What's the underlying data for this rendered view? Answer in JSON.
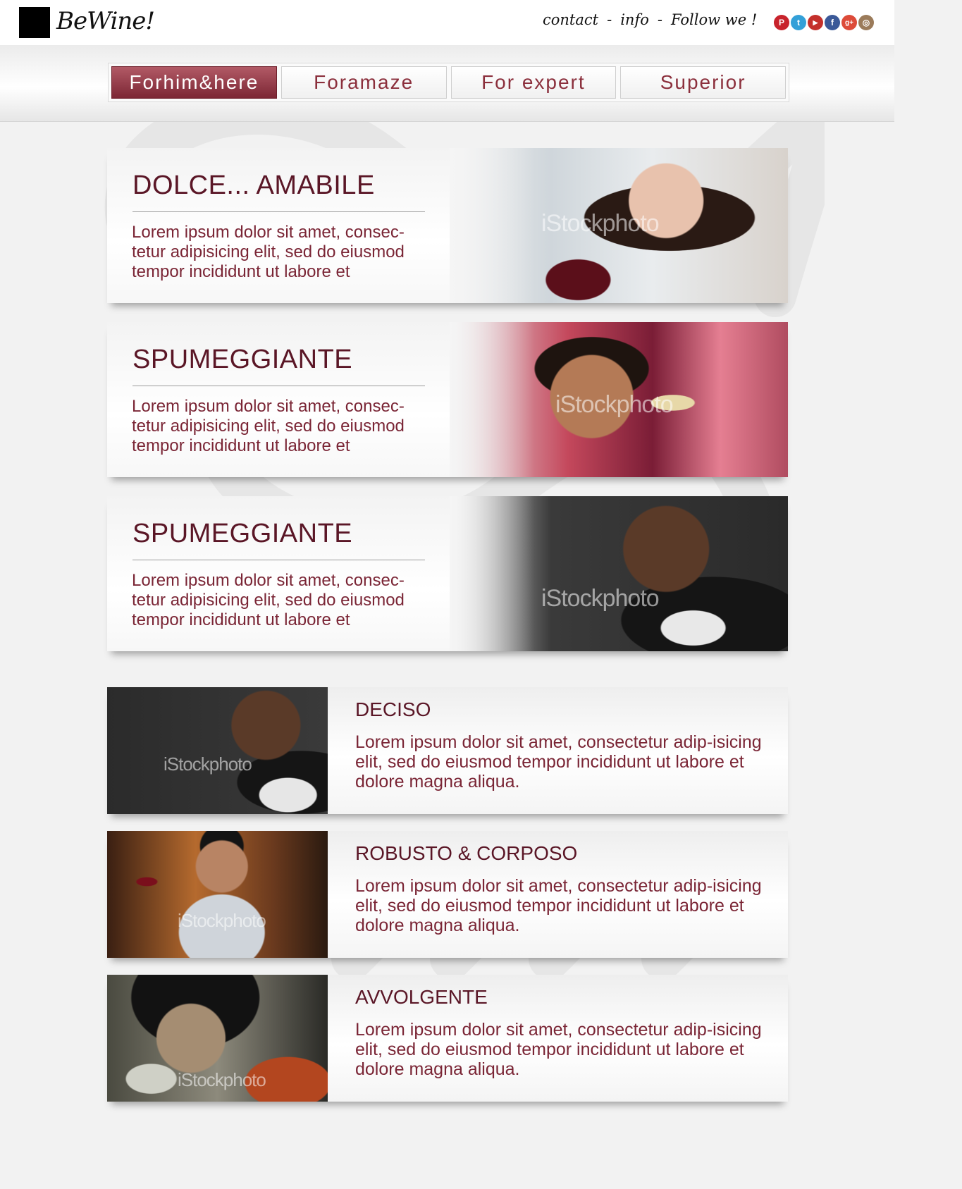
{
  "header": {
    "logo": "BeWine!",
    "links": [
      "contact",
      "info",
      "Follow we !"
    ],
    "separator": "-",
    "socials": [
      {
        "name": "pinterest-icon",
        "glyph": "P",
        "color": "#c8232c"
      },
      {
        "name": "twitter-icon",
        "glyph": "t",
        "color": "#33a0d8"
      },
      {
        "name": "youtube-icon",
        "glyph": "▶",
        "color": "#c4302b"
      },
      {
        "name": "facebook-icon",
        "glyph": "f",
        "color": "#3b5998"
      },
      {
        "name": "googleplus-icon",
        "glyph": "g+",
        "color": "#dd4b39"
      },
      {
        "name": "instagram-icon",
        "glyph": "◎",
        "color": "#9b7b5a"
      }
    ]
  },
  "nav": {
    "tabs": [
      "Forhim&here",
      "Foramaze",
      "For expert",
      "Superior"
    ],
    "active_index": 0
  },
  "featured": [
    {
      "title": "DOLCE... AMABILE",
      "body": "Lorem ipsum dolor sit amet, consec-tetur adipisicing elit, sed do eiusmod tempor incididunt ut labore et",
      "watermark": "iStockphoto"
    },
    {
      "title": "SPUMEGGIANTE",
      "body": "Lorem ipsum dolor sit amet, consec-tetur adipisicing elit, sed do eiusmod tempor incididunt ut labore et",
      "watermark": "iStockphoto"
    },
    {
      "title": "SPUMEGGIANTE",
      "body": "Lorem ipsum dolor sit amet, consec-tetur adipisicing elit, sed do eiusmod tempor incididunt ut labore et",
      "watermark": "iStockphoto"
    }
  ],
  "list": [
    {
      "title": "DECISO",
      "body": "Lorem ipsum dolor sit amet, consectetur adip-isicing elit, sed do eiusmod tempor incididunt ut labore et dolore magna aliqua.",
      "watermark": "iStockphoto"
    },
    {
      "title": "ROBUSTO & CORPOSO",
      "body": "Lorem ipsum dolor sit amet, consectetur adip-isicing elit, sed do eiusmod tempor incididunt ut labore et dolore magna aliqua.",
      "watermark": "iStockphoto"
    },
    {
      "title": "AVVOLGENTE",
      "body": "Lorem ipsum dolor sit amet, consectetur adip-isicing elit, sed do eiusmod tempor incididunt ut labore et dolore magna aliqua.",
      "watermark": "iStockphoto"
    }
  ],
  "colors": {
    "accent": "#7c2634",
    "text_wine": "#7a2535",
    "title_wine": "#5a1626"
  }
}
